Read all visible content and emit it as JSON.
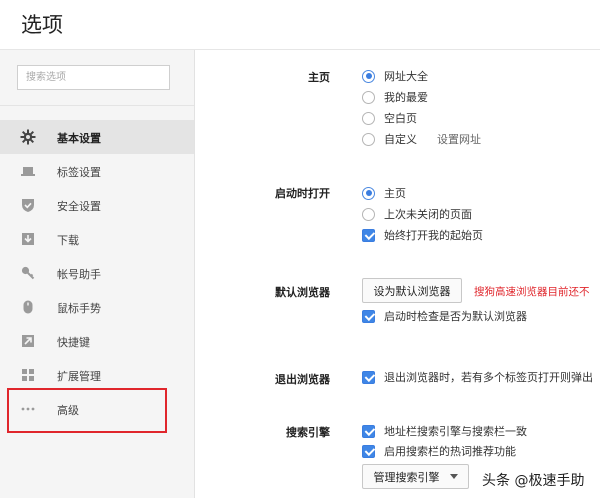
{
  "header": {
    "title": "选项"
  },
  "sidebar": {
    "search_placeholder": "搜索选项",
    "items": [
      {
        "label": "基本设置",
        "icon": "gear-icon",
        "active": true
      },
      {
        "label": "标签设置",
        "icon": "laptop-icon"
      },
      {
        "label": "安全设置",
        "icon": "shield-icon"
      },
      {
        "label": "下载",
        "icon": "download-icon"
      },
      {
        "label": "帐号助手",
        "icon": "key-icon"
      },
      {
        "label": "鼠标手势",
        "icon": "mouse-icon"
      },
      {
        "label": "快捷键",
        "icon": "shortcut-arrow-icon"
      },
      {
        "label": "扩展管理",
        "icon": "extensions-grid-icon"
      },
      {
        "label": "高级",
        "icon": "more-dots-icon"
      }
    ],
    "highlighted_item": "高级"
  },
  "settings": {
    "homepage": {
      "label": "主页",
      "options": [
        "网址大全",
        "我的最爱",
        "空白页",
        "自定义"
      ],
      "selected": "网址大全",
      "custom_link": "设置网址"
    },
    "startup": {
      "label": "启动时打开",
      "options": [
        "主页",
        "上次未关闭的页面"
      ],
      "selected": "主页",
      "checkbox": {
        "label": "始终打开我的起始页",
        "checked": true
      }
    },
    "default_browser": {
      "label": "默认浏览器",
      "button": "设为默认浏览器",
      "warning": "搜狗高速浏览器目前还不",
      "checkbox": {
        "label": "启动时检查是否为默认浏览器",
        "checked": true
      }
    },
    "exit_browser": {
      "label": "退出浏览器",
      "checkbox": {
        "label": "退出浏览器时，若有多个标签页打开则弹出",
        "checked": true
      }
    },
    "search_engine": {
      "label": "搜索引擎",
      "checkboxes": [
        {
          "label": "地址栏搜索引擎与搜索栏一致",
          "checked": true
        },
        {
          "label": "启用搜索栏的热词推荐功能",
          "checked": true
        }
      ],
      "manage_button": "管理搜索引擎"
    }
  },
  "watermark": "头条 @极速手助",
  "colors": {
    "accent": "#3f86e6",
    "warning": "#e0262c",
    "highlight_border": "#e0262c"
  }
}
